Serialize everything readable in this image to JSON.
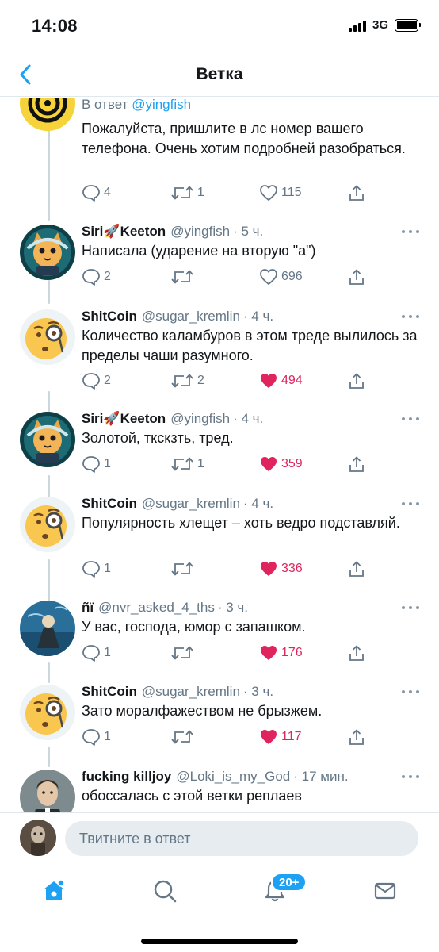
{
  "status_bar": {
    "time": "14:08",
    "network": "3G",
    "battery_level": 1.0
  },
  "nav": {
    "title": "Ветка",
    "back_icon": "chevron-left-icon"
  },
  "first_tweet": {
    "reply_label": "В ответ",
    "reply_mention": "@yingfish",
    "text": "Пожалуйста, пришлите в лс номер вашего телефона. Очень хотим подробней разобраться.",
    "replies": "4",
    "retweets": "1",
    "likes": "115"
  },
  "tweets": [
    {
      "name": "Siri🚀Keeton",
      "handle": "@yingfish",
      "time": "· 5 ч.",
      "text": "Написала (ударение на вторую \"а\")",
      "replies": "2",
      "retweets": "",
      "likes": "696",
      "liked": false
    },
    {
      "name": "ShitCoin",
      "handle": "@sugar_kremlin",
      "time": "· 4 ч.",
      "text": "Количество каламбуров в этом треде вылилось за пределы чаши разумного.",
      "replies": "2",
      "retweets": "2",
      "likes": "494",
      "liked": true
    },
    {
      "name": "Siri🚀Keeton",
      "handle": "@yingfish",
      "time": "· 4 ч.",
      "text": "Золотой, ткскзть, тред.",
      "replies": "1",
      "retweets": "1",
      "likes": "359",
      "liked": true
    },
    {
      "name": "ShitCoin",
      "handle": "@sugar_kremlin",
      "time": "· 4 ч.",
      "text": "Популярность хлещет – хоть ведро подставляй.",
      "replies": "1",
      "retweets": "",
      "likes": "336",
      "liked": true
    },
    {
      "name": "ñï",
      "handle": "@nvr_asked_4_ths",
      "time": "· 3 ч.",
      "text": "У вас, господа, юмор с запашком.",
      "replies": "1",
      "retweets": "",
      "likes": "176",
      "liked": true
    },
    {
      "name": "ShitCoin",
      "handle": "@sugar_kremlin",
      "time": "· 3 ч.",
      "text": "Зато моралфажеством не брызжем.",
      "replies": "1",
      "retweets": "",
      "likes": "117",
      "liked": true
    },
    {
      "name": "fucking killjoy",
      "handle": "@Loki_is_my_God",
      "time": "· 17 мин.",
      "text": "обоссалась с этой ветки реплаев",
      "replies": "",
      "retweets": "",
      "likes": "",
      "liked": false
    }
  ],
  "compose": {
    "placeholder": "Твитните в ответ"
  },
  "tab_bar": {
    "notifications_badge": "20+",
    "tabs": [
      "home-icon",
      "search-icon",
      "notifications-icon",
      "messages-icon"
    ]
  },
  "colors": {
    "accent": "#1da1f2",
    "like": "#e0245e",
    "secondary_text": "#657786"
  }
}
